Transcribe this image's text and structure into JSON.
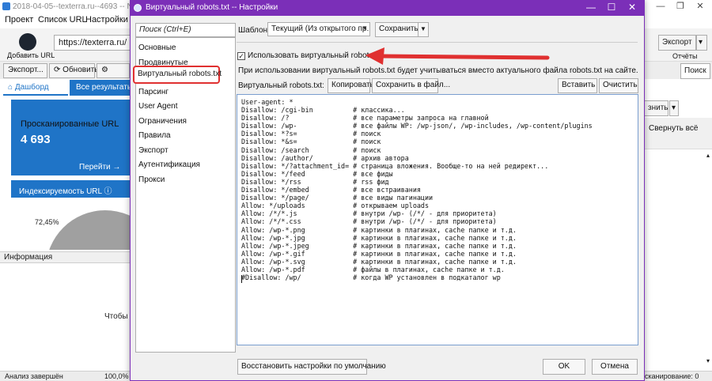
{
  "background_app": {
    "title": "2018-04-05--texterra.ru--4693 -- Netpeak Sp",
    "menu": [
      "Проект",
      "Список URL",
      "Настройки"
    ],
    "add_url_label": "Добавить URL",
    "url_value": "https://texterra.ru/",
    "export_btn": "Экспорт...",
    "refresh_btn": "Обновить",
    "tab_dashboard": "Дашборд",
    "tab_all_results": "Все результаты (4",
    "scanned_label": "Просканированные URL",
    "scanned_value": "4 693",
    "go_label": "Перейти →",
    "indexability_label": "Индексируемость URL",
    "pie_percent": "72,45%",
    "info_label": "Информация",
    "info_text": "Чтобы п",
    "status_left": "Анализ завершён",
    "status_mid": "100,0%",
    "status_right": "сканирование: 0",
    "right_export": "Экспорт",
    "right_reports": "Отчёты",
    "right_search": "Поиск",
    "right_expand": "знить",
    "right_collapse": "Свернуть всё"
  },
  "dialog": {
    "title": "Виртуальный robots.txt -- Настройки",
    "nav_search_placeholder": "Поиск (Ctrl+E)",
    "nav": [
      "Основные",
      "Продвинутые",
      "Виртуальный robots.txt",
      "Парсинг",
      "User Agent",
      "Ограничения",
      "Правила",
      "Экспорт",
      "Аутентификация",
      "Прокси"
    ],
    "template_label": "Шаблон:",
    "template_value": "Текущий (Из открытого пр...",
    "save_btn": "Сохранить",
    "checkbox_label": "Использовать виртуальный robots.txt",
    "checkbox_checked": true,
    "info_text": "При использовании виртуальный robots.txt будет учитываться вместо актуального файла robots.txt на сайте.",
    "editor_label": "Виртуальный robots.txt:",
    "copy_btn": "Копировать",
    "save_file_btn": "Сохранить в файл...",
    "paste_btn": "Вставить",
    "clear_btn": "Очистить",
    "robots_text": "User-agent: *\nDisallow: /cgi-bin          # классика...\nDisallow: /?                # все параметры запроса на главной\nDisallow: /wp-              # все файлы WP: /wp-json/, /wp-includes, /wp-content/plugins\nDisallow: *?s=              # поиск\nDisallow: *&s=              # поиск\nDisallow: /search           # поиск\nDisallow: /author/          # архив автора\nDisallow: */?attachment_id= # страница вложения. Вообще-то на ней редирект...\nDisallow: */feed            # все фиды\nDisallow: */rss             # rss фид\nDisallow: */embed           # все встраивания\nDisallow: */page/           # все виды пагинации\nAllow: */uploads            # открываем uploads\nAllow: /*/*.js              # внутри /wp- (/*/ - для приоритета)\nAllow: /*/*.css             # внутри /wp- (/*/ - для приоритета)\nAllow: /wp-*.png            # картинки в плагинах, cache папке и т.д.\nAllow: /wp-*.jpg            # картинки в плагинах, cache папке и т.д.\nAllow: /wp-*.jpeg           # картинки в плагинах, cache папке и т.д.\nAllow: /wp-*.gif            # картинки в плагинах, cache папке и т.д.\nAllow: /wp-*.svg            # картинки в плагинах, cache папке и т.д.\nAllow: /wp-*.pdf            # файлы в плагинах, cache папке и т.д.\n#Disallow: /wp/             # когда WP установлен в подкаталог wp",
    "restore_btn": "Восстановить настройки по умолчанию",
    "ok_btn": "OK",
    "cancel_btn": "Отмена"
  },
  "colors": {
    "dialog_title_bg": "#7b2fb8",
    "accent_blue": "#1f74c7",
    "highlight_red": "#e03030"
  }
}
